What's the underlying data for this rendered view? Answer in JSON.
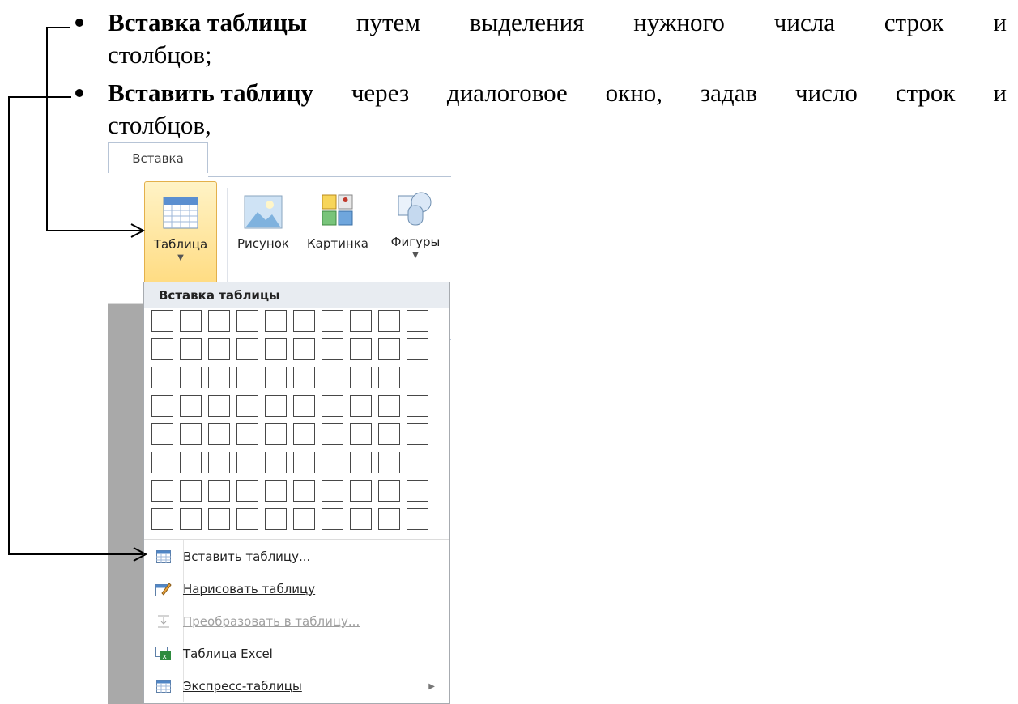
{
  "document": {
    "bullet1": {
      "bold": "Вставка таблицы",
      "rest_words": [
        "путем",
        "выделения",
        "нужного",
        "числа",
        "строк",
        "и"
      ],
      "line2": "столбцов;"
    },
    "bullet2": {
      "bold": "Вставить таблицу",
      "rest_words": [
        "через",
        "диалоговое",
        "окно,",
        "задав",
        "число",
        "строк",
        "и"
      ],
      "line2": "столбцов,"
    }
  },
  "ribbon": {
    "tab_label": "Вставка",
    "buttons": [
      {
        "label": "Таблица",
        "icon": "table-icon",
        "has_dropdown": true
      },
      {
        "label": "Рисунок",
        "icon": "picture-icon",
        "has_dropdown": false
      },
      {
        "label": "Картинка",
        "icon": "clipart-icon",
        "has_dropdown": false
      },
      {
        "label": "Фигуры",
        "icon": "shapes-icon",
        "has_dropdown": true
      }
    ]
  },
  "table_menu": {
    "header": "Вставка таблицы",
    "grid": {
      "rows": 8,
      "cols": 10
    },
    "items": [
      {
        "label": "Вставить таблицу...",
        "icon": "insert-table-icon",
        "disabled": false
      },
      {
        "label": "Нарисовать таблицу",
        "icon": "draw-table-icon",
        "disabled": false
      },
      {
        "label": "Преобразовать в таблицу...",
        "icon": "convert-table-icon",
        "disabled": true
      },
      {
        "label": "Таблица Excel",
        "icon": "excel-table-icon",
        "disabled": false
      },
      {
        "label": "Экспресс-таблицы",
        "icon": "quick-tables-icon",
        "disabled": false,
        "submenu": true
      }
    ]
  },
  "colors": {
    "highlight": "#ffd877",
    "menu_header": "#e8ecf1",
    "grid_border": "#474747"
  }
}
